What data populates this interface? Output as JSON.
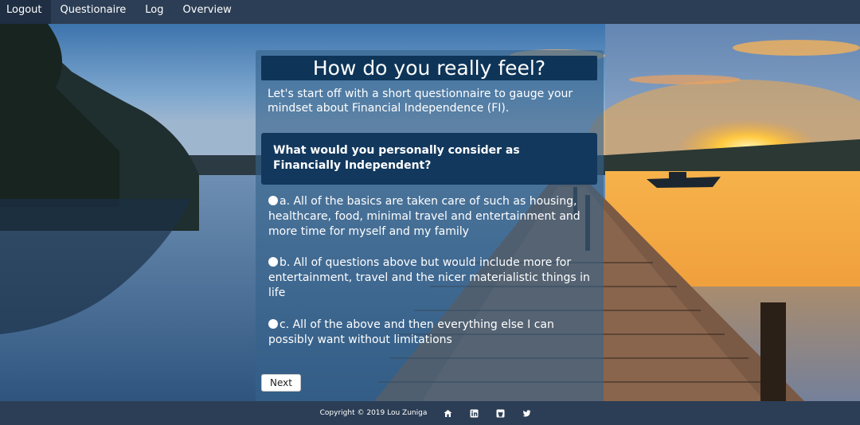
{
  "nav": {
    "items": [
      {
        "label": "Logout"
      },
      {
        "label": "Questionaire"
      },
      {
        "label": "Log"
      },
      {
        "label": "Overview"
      }
    ]
  },
  "panel": {
    "title": "How do you really feel?",
    "intro": "Let's start off with a short questionnaire to gauge your mindset about Financial Independence (FI).",
    "question": "What would you personally consider as Financially Independent?",
    "options": [
      {
        "label": "a. All of the basics are taken care of such as housing, healthcare, food, minimal travel and entertainment and more time for myself and my family"
      },
      {
        "label": "b. All of questions above but would include more for entertainment, travel and the nicer materialistic things in life"
      },
      {
        "label": "c. All of the above and then everything else I can possibly want without limitations"
      }
    ],
    "next_label": "Next"
  },
  "footer": {
    "copyright": "Copyright © 2019 Lou Zuniga",
    "icons": [
      "home-icon",
      "linkedin-icon",
      "github-icon",
      "twitter-icon"
    ]
  },
  "colors": {
    "nav_bg": "#2c3e55",
    "panel_title_bg": "#0e3558",
    "question_bg": "#12385d"
  }
}
